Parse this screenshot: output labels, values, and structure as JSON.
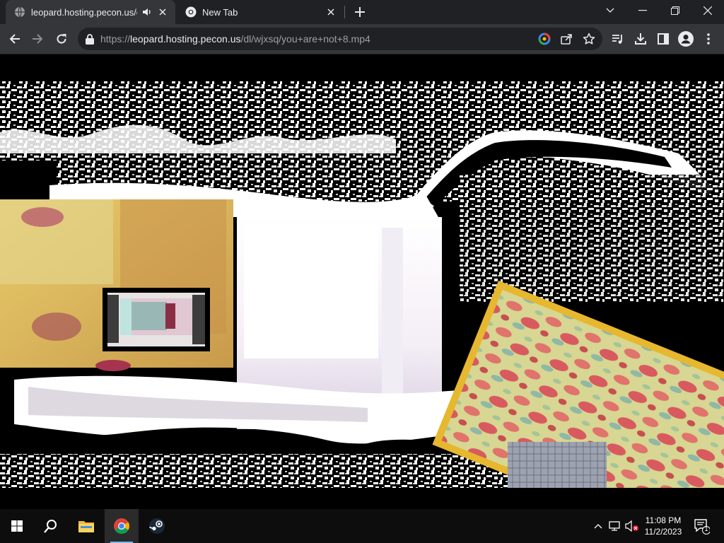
{
  "browser": {
    "tabs": [
      {
        "title": "leopard.hosting.pecon.us/dl/",
        "active": true,
        "audio": true,
        "favicon": "globe-icon"
      },
      {
        "title": "New Tab",
        "active": false,
        "audio": false,
        "favicon": "chrome-icon"
      }
    ],
    "address_bar": {
      "prefix": "https://",
      "host": "leopard.hosting.pecon.us",
      "path": "/dl/wjxsq/you+are+not+8.mp4"
    },
    "toolbar_icons": [
      "back-icon",
      "forward-icon",
      "reload-icon",
      "lock-icon",
      "google-lens-icon",
      "share-icon",
      "star-icon",
      "media-control-icon",
      "download-icon",
      "side-panel-icon",
      "profile-icon",
      "kebab-menu-icon"
    ]
  },
  "content": {
    "type": "video",
    "description_visible": false
  },
  "taskbar": {
    "apps": [
      "start-icon",
      "search-icon",
      "file-explorer-icon",
      "chrome-icon",
      "steam-icon"
    ],
    "active_app": "chrome-icon",
    "tray": [
      "chevron-up-icon",
      "network-icon",
      "volume-muted-icon"
    ],
    "clock": {
      "time": "11:08 PM",
      "date": "11/2/2023"
    },
    "notifications": {
      "count": "1"
    }
  },
  "colors": {
    "tab_strip": "#202124",
    "toolbar": "#35363a",
    "omnibox": "#202124",
    "taskbar": "#0d0d0d",
    "accent": "#76b9ed"
  }
}
